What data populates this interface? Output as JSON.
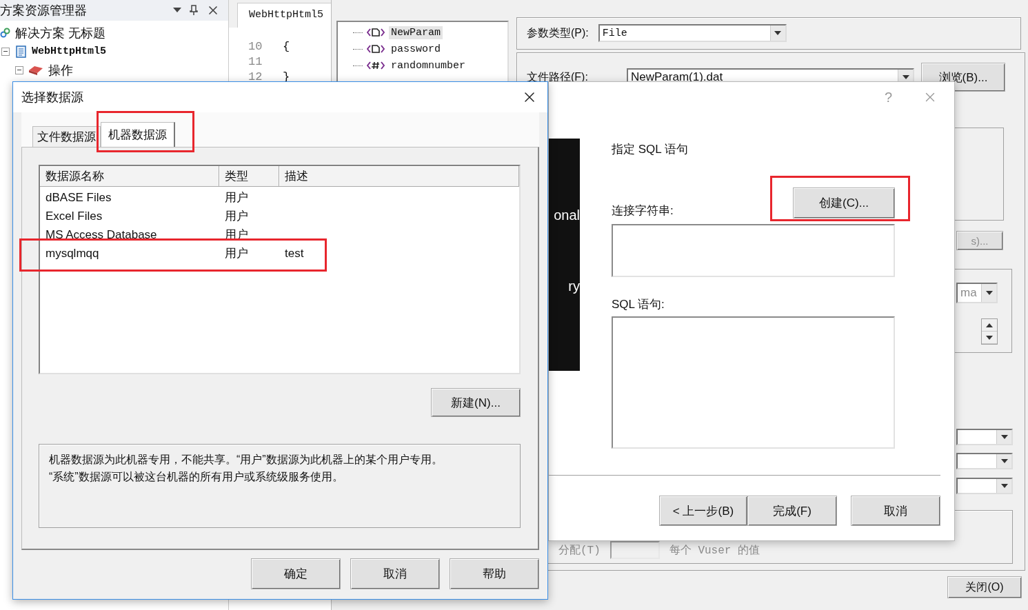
{
  "solution_explorer": {
    "title": "方案资源管理器",
    "items": [
      {
        "kind": "solution",
        "label": "解决方案 无标题",
        "children": [
          {
            "kind": "project",
            "label": "WebHttpHtml5",
            "expanded": true,
            "children": [
              {
                "kind": "actions",
                "label": "操作",
                "expanded": true
              }
            ]
          }
        ]
      }
    ]
  },
  "editor": {
    "tab": "WebHttpHtml5",
    "lines": [
      {
        "number": "10",
        "code": "{"
      },
      {
        "number": "11"
      },
      {
        "number": "12",
        "code": "}"
      }
    ]
  },
  "parameters": {
    "items": [
      {
        "kind": "file",
        "label": "NewParam",
        "selected": true
      },
      {
        "kind": "file",
        "label": "password",
        "selected": false
      },
      {
        "kind": "number",
        "label": "randomnumber",
        "selected": false
      }
    ]
  },
  "param_type": {
    "label": "参数类型(P):",
    "value": "File"
  },
  "file_path": {
    "label": "文件路径(F):",
    "value": "NewParam(1).dat",
    "browse_button": "浏览(B)..."
  },
  "partial_button": "s)...",
  "partial_combo": "ma",
  "allocation": {
    "label": "分配(T)",
    "note": "每个 Vuser 的值"
  },
  "close_button": "关闭(O)",
  "sql_wizard": {
    "help": "?",
    "banner_texts": [
      "onal",
      "ry"
    ],
    "heading": "指定 SQL 语句",
    "connection_label": "连接字符串:",
    "create_button": {
      "label": "创建(C)...",
      "highlighted": true
    },
    "sql_label": "SQL 语句:",
    "buttons": [
      "< 上一步(B)",
      "完成(F)",
      "取消"
    ]
  },
  "data_source_dialog": {
    "title": "选择数据源",
    "tabs": [
      {
        "label": "文件数据源",
        "selected": false,
        "highlighted": false
      },
      {
        "label": "机器数据源",
        "selected": true,
        "highlighted": true
      }
    ],
    "columns": [
      "数据源名称",
      "类型",
      "描述"
    ],
    "rows": [
      {
        "cells": [
          "dBASE Files",
          "用户"
        ],
        "highlighted": false
      },
      {
        "cells": [
          "Excel Files",
          "用户"
        ],
        "highlighted": false
      },
      {
        "cells": [
          "MS Access Database",
          "用户"
        ],
        "highlighted": false
      },
      {
        "cells": [
          "mysqlmqq",
          "用户",
          "test"
        ],
        "highlighted": true
      }
    ],
    "new_button": "新建(N)...",
    "info_lines": [
      "机器数据源为此机器专用，不能共享。“用户”数据源为此机器上的某个用户专用。",
      "“系统”数据源可以被这台机器的所有用户或系统级服务使用。"
    ],
    "buttons": [
      "确定",
      "取消",
      "帮助"
    ]
  }
}
